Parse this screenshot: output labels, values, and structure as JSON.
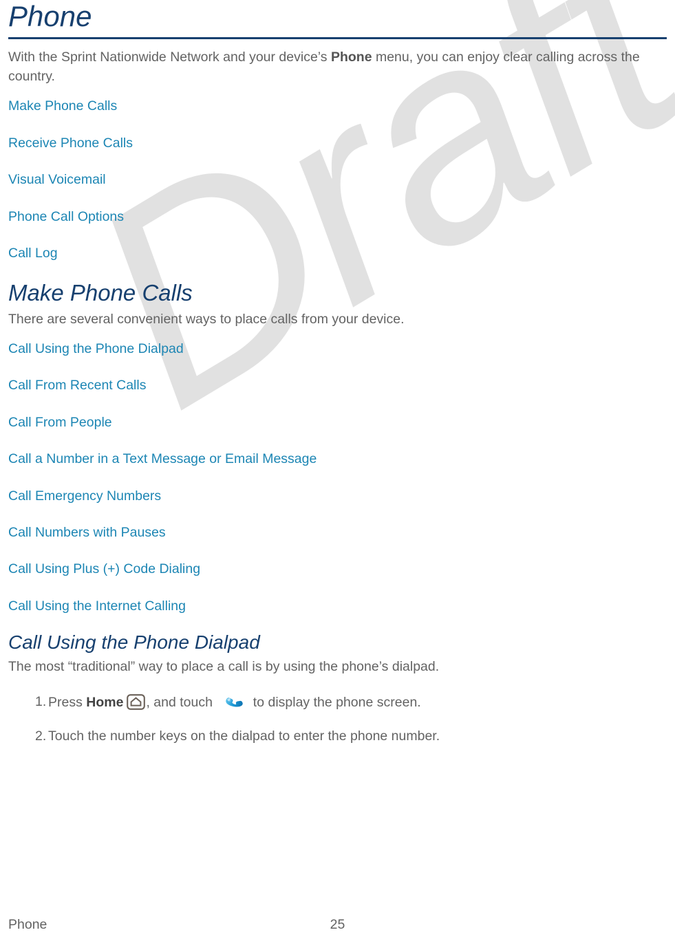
{
  "document": {
    "watermark": "Draft",
    "accent_navy": "#17406f",
    "link_blue": "#1d86b4",
    "body_gray": "#636363",
    "watermark_gray": "#e1e1e1"
  },
  "header": {
    "title": "Phone"
  },
  "intro": {
    "part1": "With the Sprint Nationwide Network and your device’s ",
    "bold": "Phone",
    "part2": " menu, you can enjoy clear calling across the country."
  },
  "toc_main": {
    "items": [
      {
        "label": "Make Phone Calls"
      },
      {
        "label": "Receive Phone Calls"
      },
      {
        "label": "Visual Voicemail"
      },
      {
        "label": "Phone Call Options"
      },
      {
        "label": "Call Log"
      }
    ]
  },
  "section_make_calls": {
    "heading": "Make Phone Calls",
    "description": "There are several convenient ways to place calls from your device.",
    "items": [
      {
        "label": "Call Using the Phone Dialpad"
      },
      {
        "label": "Call From Recent Calls"
      },
      {
        "label": "Call From People"
      },
      {
        "label": "Call a Number in a Text Message or Email Message"
      },
      {
        "label": "Call Emergency Numbers"
      },
      {
        "label": "Call Numbers with Pauses"
      },
      {
        "label": "Call Using Plus (+) Code Dialing"
      },
      {
        "label": "Call Using the Internet Calling"
      }
    ]
  },
  "section_dialpad": {
    "heading": "Call Using the Phone Dialpad",
    "description": "The most “traditional” way to place a call is by using the phone’s dialpad.",
    "steps": [
      {
        "number": "1.",
        "text_before_bold": "Press ",
        "bold": "Home",
        "text_mid": ", and touch ",
        "text_after": " to display the phone screen.",
        "icons": [
          "home-icon",
          "phone-handset-icon"
        ]
      },
      {
        "number": "2.",
        "text": "Touch the number keys on the dialpad to enter the phone number."
      }
    ]
  },
  "footer": {
    "left": "Phone",
    "page_number": "25"
  }
}
